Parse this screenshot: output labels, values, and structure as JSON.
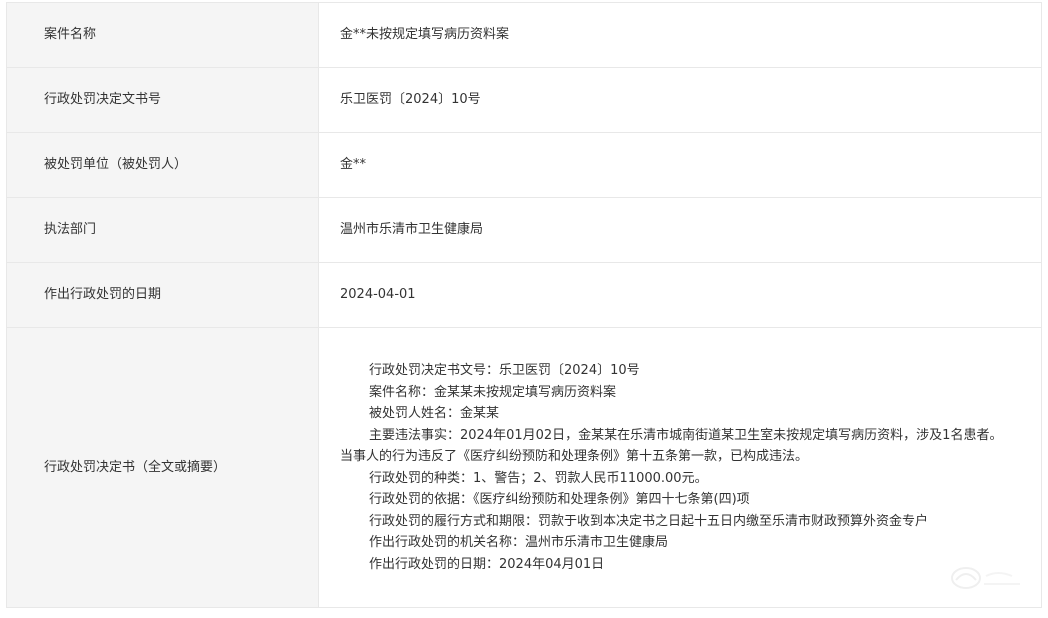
{
  "rows": [
    {
      "label": "案件名称",
      "value": "金**未按规定填写病历资料案"
    },
    {
      "label": "行政处罚决定文书号",
      "value": "乐卫医罚〔2024〕10号"
    },
    {
      "label": "被处罚单位（被处罚人）",
      "value": "金**"
    },
    {
      "label": "执法部门",
      "value": "温州市乐清市卫生健康局"
    },
    {
      "label": "作出行政处罚的日期",
      "value": "2024-04-01"
    }
  ],
  "full_text": {
    "label": "行政处罚决定书（全文或摘要）",
    "lines": [
      "行政处罚决定书文号：乐卫医罚〔2024〕10号",
      "案件名称：金某某未按规定填写病历资料案",
      "被处罚人姓名：金某某",
      "主要违法事实：2024年01月02日，金某某在乐清市城南街道某卫生室未按规定填写病历资料，涉及1名患者。",
      "当事人的行为违反了《医疗纠纷预防和处理条例》第十五条第一款，已构成违法。",
      "行政处罚的种类：1、警告；2、罚款人民币11000.00元。",
      "行政处罚的依据：《医疗纠纷预防和处理条例》第四十七条第(四)项",
      "行政处罚的履行方式和期限：罚款于收到本决定书之日起十五日内缴至乐清市财政预算外资金专户",
      "作出行政处罚的机关名称：温州市乐清市卫生健康局",
      "作出行政处罚的日期：2024年04月01日"
    ]
  },
  "colors": {
    "label_bg": "#f5f5f5",
    "border": "#e8e8e8",
    "text": "#333333"
  }
}
